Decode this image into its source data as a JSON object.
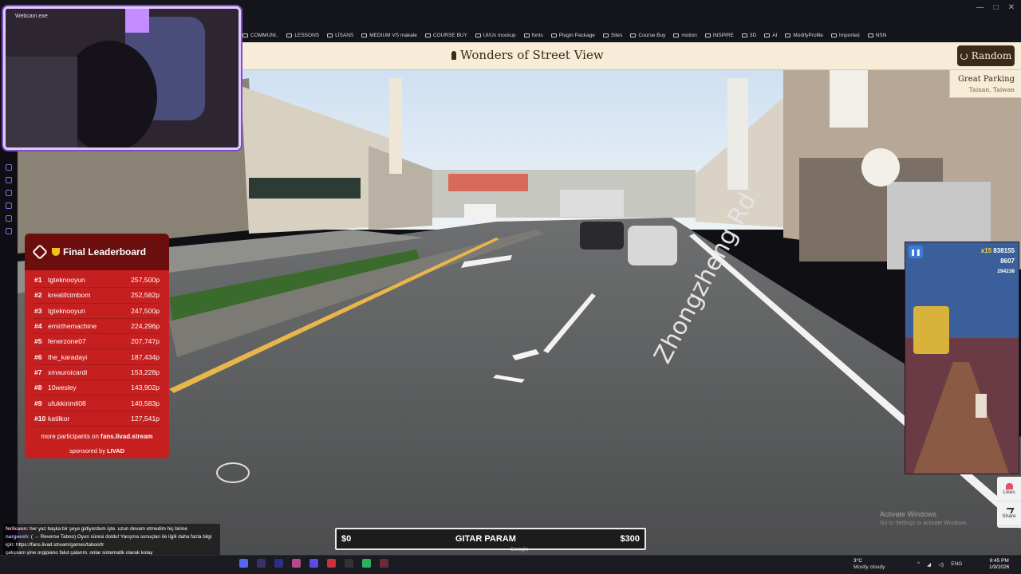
{
  "browser": {
    "bookmarks": [
      "COMMUNI..",
      "LESSONS",
      "LİSANS",
      "MEDIUM VS makale",
      "COURSE BUY",
      "UI/Ux mockup",
      "fonts",
      "Plugin Package",
      "Sites",
      "Course Buy",
      "motion",
      "INSPIRE",
      "3D",
      "AI",
      "ModifyProfile",
      "Imported",
      "NSN"
    ]
  },
  "site": {
    "title": "Wonders of Street View",
    "random_label": "Random",
    "location_name": "Great Parking",
    "location_sub": "Tainan, Taiwan",
    "road_label": "Zhongzheng Rd"
  },
  "webcam": {
    "label": "Webcam.exe"
  },
  "leaderboard": {
    "title": "Final Leaderboard",
    "entries": [
      {
        "rank": "#1",
        "name": "tgteknooyun",
        "score": "257,500p"
      },
      {
        "rank": "#2",
        "name": "kreatifcimbom",
        "score": "252,582p"
      },
      {
        "rank": "#3",
        "name": "tgteknooyun",
        "score": "247,500p"
      },
      {
        "rank": "#4",
        "name": "emirthemachine",
        "score": "224,296p"
      },
      {
        "rank": "#5",
        "name": "fenerzone07",
        "score": "207,747p"
      },
      {
        "rank": "#6",
        "name": "the_karadayi",
        "score": "187,434p"
      },
      {
        "rank": "#7",
        "name": "xmauroicardi",
        "score": "153,228p"
      },
      {
        "rank": "#8",
        "name": "10wesley",
        "score": "143,902p"
      },
      {
        "rank": "#9",
        "name": "ufukkirimli08",
        "score": "140,583p"
      },
      {
        "rank": "#10",
        "name": "katilkor",
        "score": "127,541p"
      }
    ],
    "footer_prefix": "more participants on",
    "footer_link": "fans.livad.stream",
    "sponsor_text": "sponsored by",
    "sponsor_brand": "LIVAD"
  },
  "game": {
    "multiplier": "x15",
    "score": "838155",
    "coins": "8607",
    "best": "294238"
  },
  "side_actions": {
    "likes": "Likes",
    "share": "Share"
  },
  "goal": {
    "start": "$0",
    "label": "GITAR PARAM",
    "end": "$300",
    "progress": 0
  },
  "overlay": {
    "activate_title": "Activate Windows",
    "activate_sub": "Go to Settings to activate Windows.",
    "google": "Google"
  },
  "chat": [
    {
      "user": "ferlicann:",
      "text": "her yaz başka bir şeye gidiyordum işte. uzun devam etmedim hiç birine"
    },
    {
      "user": "nargeesh:",
      "text": "( → Reverse Taboo) Oyun süresi doldu! Yarışma sonuçları ile ilgili daha fazla bilgi için: https://fans.livad.stream/games/taboo/tr"
    },
    {
      "user": "",
      "text": "çalışsam yine orgipiano falut çalarım. onlar sistematik olarak kolay"
    }
  ],
  "taskbar": {
    "weather_temp": "3°C",
    "weather_desc": "Mostly cloudy",
    "lang": "ENG",
    "time": "9:45 PM",
    "date": "1/9/2026"
  },
  "colors": {
    "accent": "#c61f1f",
    "header_bg": "#f6ecd8",
    "button_bg": "#3a2a1a",
    "webcam_border": "#e6c8ff"
  }
}
